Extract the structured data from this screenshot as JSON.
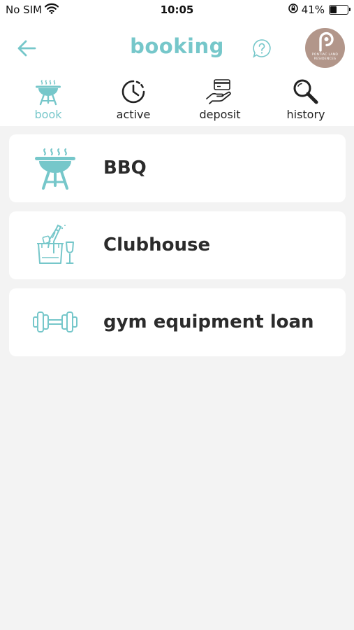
{
  "status_bar": {
    "carrier": "No SIM",
    "time": "10:05",
    "battery_percent": "41%"
  },
  "header": {
    "title": "booking",
    "avatar_text": "PONTIAC LAND RESIDENCES"
  },
  "tabs": [
    {
      "label": "book",
      "icon": "bbq-grill-icon",
      "active": true
    },
    {
      "label": "active",
      "icon": "clock-icon",
      "active": false
    },
    {
      "label": "deposit",
      "icon": "card-hand-icon",
      "active": false
    },
    {
      "label": "history",
      "icon": "magnifier-icon",
      "active": false
    }
  ],
  "facilities": [
    {
      "label": "BBQ",
      "icon": "bbq-grill-icon"
    },
    {
      "label": "Clubhouse",
      "icon": "champagne-bucket-icon"
    },
    {
      "label": "gym equipment loan",
      "icon": "dumbbell-icon"
    }
  ],
  "colors": {
    "accent": "#76c7ca",
    "background": "#f3f3f3",
    "avatar": "#b2968a"
  }
}
